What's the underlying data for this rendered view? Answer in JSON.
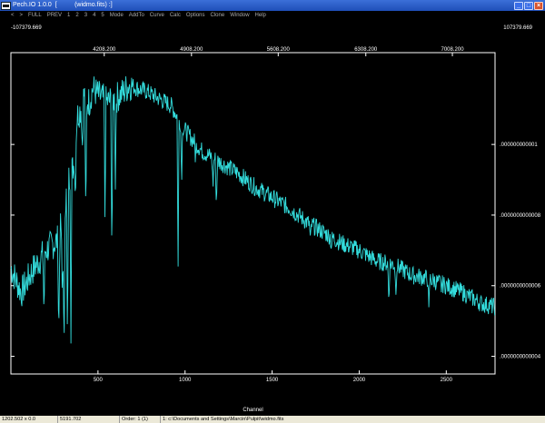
{
  "window": {
    "title": "Pech.IO 1.0.0  [          (widmo.fits) :]",
    "minimize": "_",
    "maximize": "□",
    "close": "×"
  },
  "menu": [
    "<",
    ">",
    "FULL",
    "PREV",
    "1",
    "2",
    "3",
    "4",
    "5",
    "Mode",
    "AddTo",
    "Curve",
    "Calc",
    "Options",
    "Clone",
    "Window",
    "Help"
  ],
  "corners": {
    "left": "-107379.669",
    "right": "107379.669"
  },
  "colors": {
    "background": "#000000",
    "axis": "#ffffff",
    "spectrum": "#33dcdc"
  },
  "chart_data": {
    "type": "line",
    "xlabel": "Channel",
    "xlim": [
      0,
      2780
    ],
    "ylim": [
      3.5e-13,
      1.26e-12
    ],
    "x_ticks": [
      500,
      1000,
      1500,
      2000,
      2500
    ],
    "top_ticks": [
      "4208.200",
      "4908.200",
      "5608.200",
      "6308.200",
      "7008.200"
    ],
    "top_tick_channels": [
      536,
      1037,
      1535,
      2038,
      2535
    ],
    "y_ticks": [
      1e-12,
      8e-13,
      6e-13,
      4e-13
    ],
    "y_tick_labels": [
      ".000000000001",
      ".0000000000008",
      ".0000000000006",
      ".0000000000004"
    ],
    "grid": false,
    "series": [
      {
        "points": [
          [
            0,
            6.5e-13
          ],
          [
            60,
            5.8e-13
          ],
          [
            120,
            6.4e-13
          ],
          [
            200,
            7e-13
          ],
          [
            270,
            7.3e-13
          ],
          [
            300,
            7.9e-13
          ],
          [
            330,
            9e-13
          ],
          [
            360,
            9.4e-13
          ],
          [
            380,
            1.08e-12
          ],
          [
            400,
            1.1e-12
          ],
          [
            420,
            1.14e-12
          ],
          [
            450,
            1.12e-12
          ],
          [
            470,
            1.16e-12
          ],
          [
            500,
            1.14e-12
          ],
          [
            550,
            1.12e-12
          ],
          [
            600,
            1.13e-12
          ],
          [
            650,
            1.15e-12
          ],
          [
            680,
            1.17e-12
          ],
          [
            720,
            1.16e-12
          ],
          [
            780,
            1.15e-12
          ],
          [
            850,
            1.13e-12
          ],
          [
            920,
            1.11e-12
          ],
          [
            1000,
            1.04e-12
          ],
          [
            1100,
            9.8e-13
          ],
          [
            1200,
            9.5e-13
          ],
          [
            1300,
            9.2e-13
          ],
          [
            1400,
            8.8e-13
          ],
          [
            1500,
            8.5e-13
          ],
          [
            1600,
            8.2e-13
          ],
          [
            1700,
            7.8e-13
          ],
          [
            1800,
            7.5e-13
          ],
          [
            1900,
            7.2e-13
          ],
          [
            2000,
            7e-13
          ],
          [
            2100,
            6.7e-13
          ],
          [
            2200,
            6.6e-13
          ],
          [
            2300,
            6.3e-13
          ],
          [
            2400,
            6.2e-13
          ],
          [
            2500,
            6e-13
          ],
          [
            2600,
            5.8e-13
          ],
          [
            2700,
            5.5e-13
          ],
          [
            2780,
            5.4e-13
          ]
        ],
        "absorption_lines": [
          [
            190,
            5.2e-13
          ],
          [
            275,
            4.5e-13
          ],
          [
            295,
            5.5e-13
          ],
          [
            305,
            3.5e-13
          ],
          [
            325,
            4e-13
          ],
          [
            345,
            4.8e-13
          ],
          [
            370,
            8.5e-13
          ],
          [
            410,
            9.8e-13
          ],
          [
            430,
            7.5e-13
          ],
          [
            540,
            8e-13
          ],
          [
            580,
            6.8e-13
          ],
          [
            600,
            9e-13
          ],
          [
            960,
            6.5e-13
          ],
          [
            980,
            9e-13
          ],
          [
            1060,
            9.6e-13
          ],
          [
            1160,
            8.8e-13
          ],
          [
            1180,
            8.2e-13
          ],
          [
            1720,
            7.2e-13
          ],
          [
            1840,
            7.1e-13
          ],
          [
            2170,
            5.5e-13
          ],
          [
            2210,
            5.8e-13
          ],
          [
            2400,
            5.2e-13
          ],
          [
            2470,
            5.9e-13
          ],
          [
            2620,
            5.7e-13
          ]
        ]
      }
    ]
  },
  "status": {
    "coords": "1202.502 x 0.0",
    "value": "5191.702",
    "order": "Order: 1 (1)",
    "path": "1: c:\\Documents and Settings\\Marcin\\Pulpit\\widmo.fits"
  }
}
